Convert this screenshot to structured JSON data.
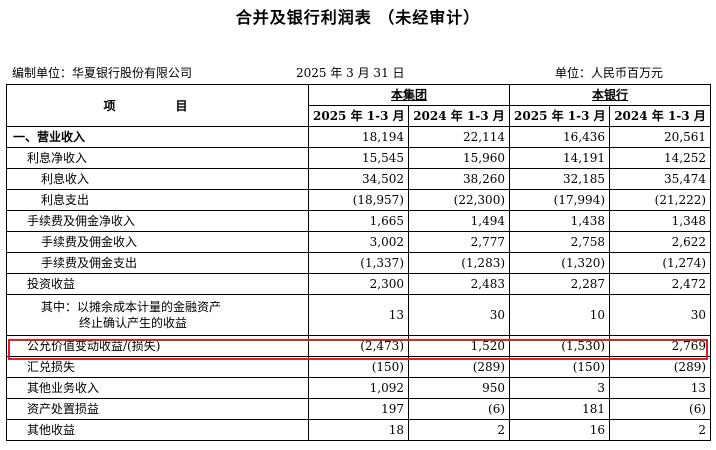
{
  "title": "合并及银行利润表 （未经审计）",
  "meta": {
    "company": "编制单位：华夏银行股份有限公司",
    "date": "2025 年 3 月 31 日",
    "unit": "单位：人民币百万元"
  },
  "header": {
    "item": "项　目",
    "group_consolidated": "本集团",
    "group_bank": "本银行",
    "col_2025": "2025 年 1-3 月",
    "col_2024": "2024 年 1-3 月"
  },
  "rows": [
    {
      "item": "一、营业收入",
      "v": [
        "18,194",
        "22,114",
        "16,436",
        "20,561"
      ]
    },
    {
      "item": "利息净收入",
      "v": [
        "15,545",
        "15,960",
        "14,191",
        "14,252"
      ]
    },
    {
      "item": "利息收入",
      "v": [
        "34,502",
        "38,260",
        "32,185",
        "35,474"
      ]
    },
    {
      "item": "利息支出",
      "v": [
        "(18,957)",
        "(22,300)",
        "(17,994)",
        "(21,222)"
      ]
    },
    {
      "item": "手续费及佣金净收入",
      "v": [
        "1,665",
        "1,494",
        "1,438",
        "1,348"
      ]
    },
    {
      "item": "手续费及佣金收入",
      "v": [
        "3,002",
        "2,777",
        "2,758",
        "2,622"
      ]
    },
    {
      "item": "手续费及佣金支出",
      "v": [
        "(1,337)",
        "(1,283)",
        "(1,320)",
        "(1,274)"
      ]
    },
    {
      "item": "投资收益",
      "v": [
        "2,300",
        "2,483",
        "2,287",
        "2,472"
      ]
    },
    {
      "item_line1": "其中：以摊余成本计量的金融资产",
      "item_line2": "终止确认产生的收益",
      "v": [
        "13",
        "30",
        "10",
        "30"
      ]
    },
    {
      "item": "公允价值变动收益/(损失)",
      "v": [
        "(2,473)",
        "1,520",
        "(1,530)",
        "2,769"
      ]
    },
    {
      "item": "汇兑损失",
      "v": [
        "(150)",
        "(289)",
        "(150)",
        "(289)"
      ]
    },
    {
      "item": "其他业务收入",
      "v": [
        "1,092",
        "950",
        "3",
        "13"
      ]
    },
    {
      "item": "资产处置损益",
      "v": [
        "197",
        "(6)",
        "181",
        "(6)"
      ]
    },
    {
      "item": "其他收益",
      "v": [
        "18",
        "2",
        "16",
        "2"
      ]
    }
  ]
}
